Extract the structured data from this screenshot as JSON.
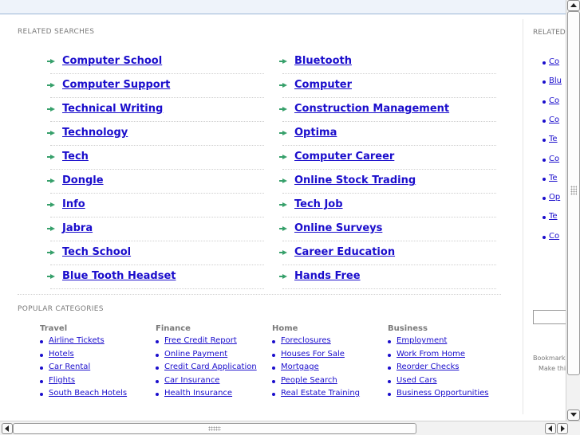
{
  "related": {
    "title": "RELATED SEARCHES",
    "left": [
      "Computer School",
      "Computer Support",
      "Technical Writing",
      "Technology",
      "Tech",
      "Dongle",
      "Info",
      "Jabra",
      "Tech School",
      "Blue Tooth Headset"
    ],
    "right": [
      "Bluetooth",
      "Computer",
      "Construction Management",
      "Optima",
      "Computer Career",
      "Online Stock Trading",
      "Tech Job",
      "Online Surveys",
      "Career Education",
      "Hands Free"
    ]
  },
  "popular": {
    "title": "POPULAR CATEGORIES",
    "categories": [
      {
        "name": "Travel",
        "links": [
          "Airline Tickets",
          "Hotels",
          "Car Rental",
          "Flights",
          "South Beach Hotels"
        ]
      },
      {
        "name": "Finance",
        "links": [
          "Free Credit Report",
          "Online Payment",
          "Credit Card Application",
          "Car Insurance",
          "Health Insurance"
        ]
      },
      {
        "name": "Home",
        "links": [
          "Foreclosures",
          "Houses For Sale",
          "Mortgage",
          "People Search",
          "Real Estate Training"
        ]
      },
      {
        "name": "Business",
        "links": [
          "Employment",
          "Work From Home",
          "Reorder Checks",
          "Used Cars",
          "Business Opportunities"
        ]
      }
    ]
  },
  "sidebar": {
    "title": "RELATED",
    "items": [
      "Co",
      "Blu",
      "Co",
      "Co",
      "Te",
      "Co",
      "Te",
      "Op",
      "Te",
      "Co"
    ],
    "bookmark_text": "Bookmark",
    "make_text": "Make thi"
  }
}
